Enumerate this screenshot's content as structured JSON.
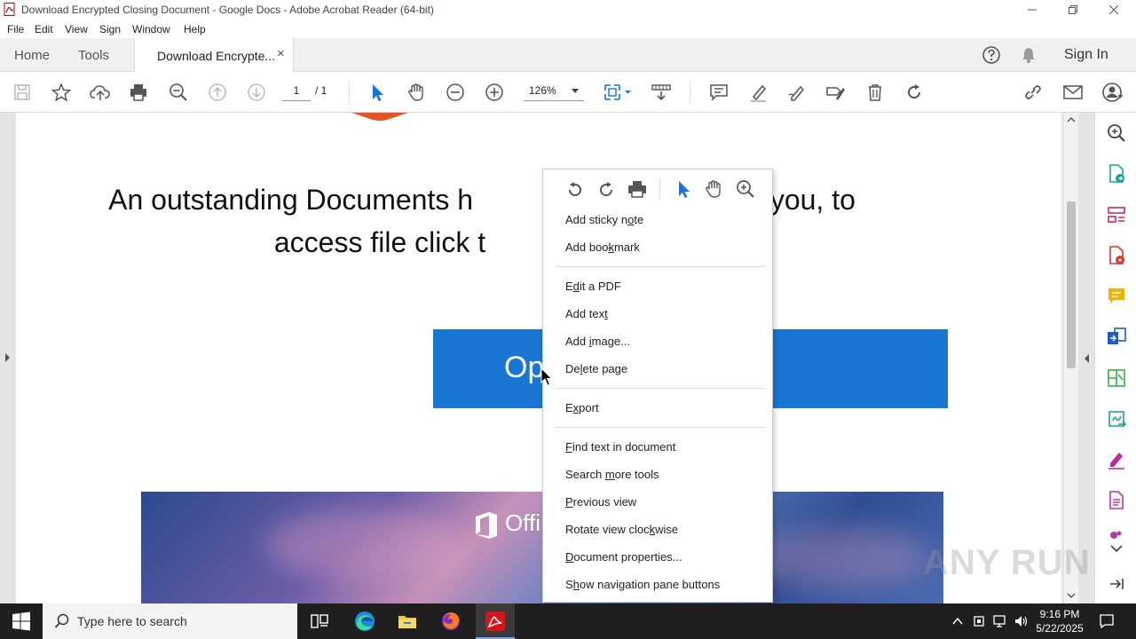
{
  "window": {
    "title": "Download Encrypted Closing Document - Google Docs - Adobe Acrobat Reader (64-bit)"
  },
  "menu": [
    "File",
    "Edit",
    "View",
    "Sign",
    "Window",
    "Help"
  ],
  "tabs": {
    "home": "Home",
    "tools": "Tools",
    "document": "Download Encrypte...",
    "close": "×",
    "sign_in": "Sign In"
  },
  "toolbar": {
    "page_current": "1",
    "page_total": "/ 1",
    "zoom": "126%"
  },
  "document": {
    "headline_line1": "An outstanding Documents h",
    "headline_line1_right": "with you, to",
    "headline_line2": "access file click t",
    "open_button": "Op",
    "banner_text": "Offi"
  },
  "context_menu": {
    "items": [
      {
        "label": "Add sticky note",
        "mnemonic_index": 12
      },
      {
        "label": "Add bookmark",
        "mnemonic_index": 7
      },
      {
        "label": "Edit a PDF",
        "mnemonic_index": 1
      },
      {
        "label": "Add text",
        "mnemonic_index": 7
      },
      {
        "label": "Add image...",
        "mnemonic_index": 4
      },
      {
        "label": "Delete page",
        "mnemonic_index": 2
      },
      {
        "label": "Export",
        "mnemonic_index": 1
      },
      {
        "label": "Find text in document",
        "mnemonic_index": 0
      },
      {
        "label": "Search more tools",
        "mnemonic_index": 7
      },
      {
        "label": "Previous view",
        "mnemonic_index": 0
      },
      {
        "label": "Rotate view clockwise",
        "mnemonic_index": 16
      },
      {
        "label": "Document properties...",
        "mnemonic_index": 0
      },
      {
        "label": "Show navigation pane buttons",
        "mnemonic_index": 1
      }
    ]
  },
  "taskbar": {
    "search_placeholder": "Type here to search",
    "time": "9:16 PM",
    "date": "5/22/2025"
  },
  "watermark": "ANY RUN",
  "colors": {
    "accent_blue": "#1976d2",
    "acrobat_red": "#d7141a"
  }
}
